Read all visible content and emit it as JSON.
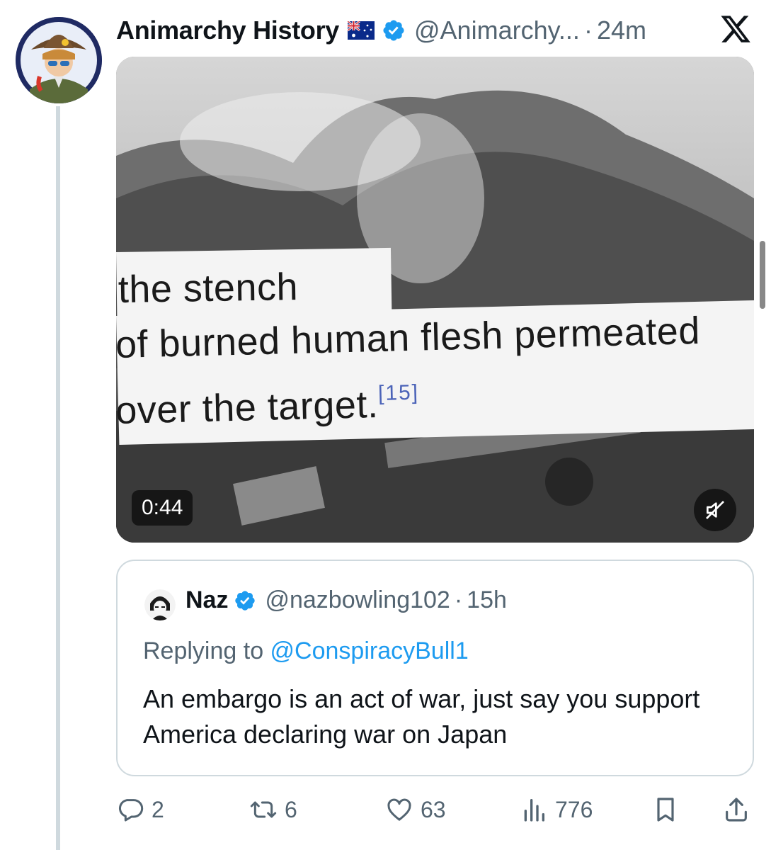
{
  "post": {
    "author_name": "Animarchy History",
    "author_handle": "@Animarchy...",
    "time": "24m",
    "separator": "·"
  },
  "video": {
    "caption_line1": "the stench",
    "caption_line2": "of burned human flesh permeated",
    "caption_line3": "over the target.",
    "citation": "[15]",
    "duration": "0:44"
  },
  "quote": {
    "author_name": "Naz",
    "author_handle": "@nazbowling102",
    "separator": "·",
    "time": "15h",
    "replying_prefix": "Replying to ",
    "replying_to": "@ConspiracyBull1",
    "text": "An embargo is an act of war, just say you support America declaring war on Japan"
  },
  "actions": {
    "replies": "2",
    "reposts": "6",
    "likes": "63",
    "views": "776"
  },
  "colors": {
    "verified": "#1d9bf0",
    "secondary_text": "#536471",
    "border": "#cfd9de",
    "link": "#1d9bf0"
  },
  "icons": [
    "x-logo-icon",
    "verified-badge-icon",
    "australia-flag-icon",
    "mute-icon",
    "reply-icon",
    "repost-icon",
    "like-icon",
    "views-icon",
    "bookmark-icon",
    "share-icon"
  ]
}
